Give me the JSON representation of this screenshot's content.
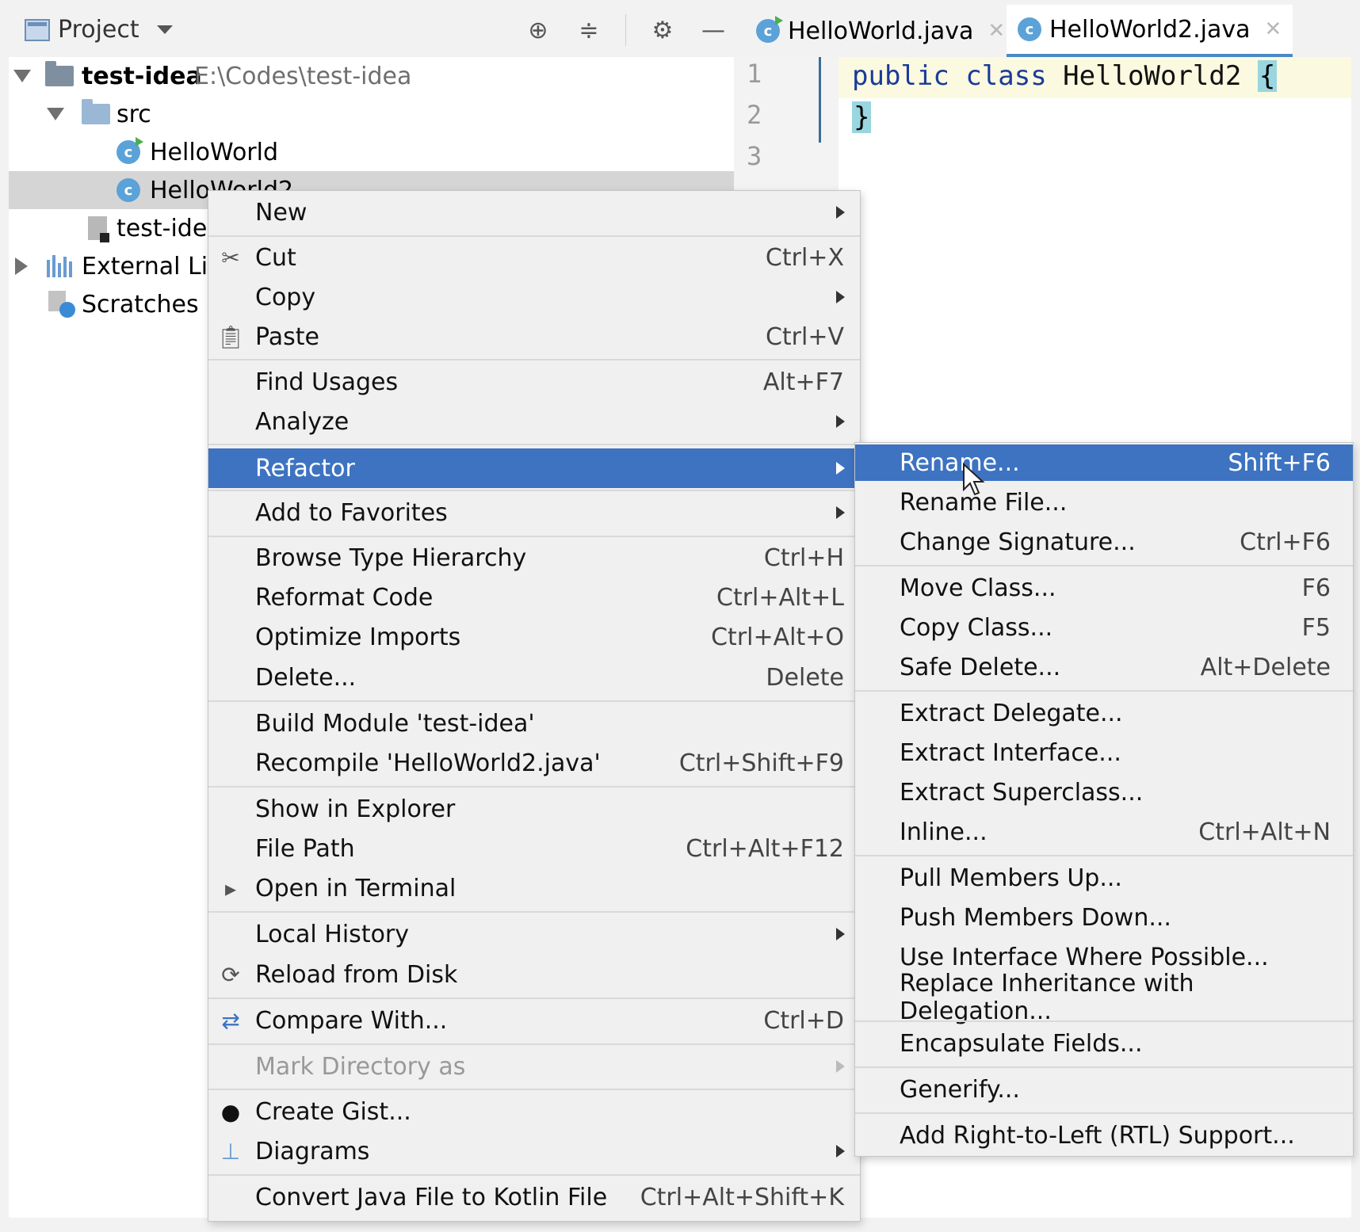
{
  "project_panel": {
    "title": "Project",
    "tree": {
      "root_name": "test-idea",
      "root_path": "E:\\Codes\\test-idea",
      "src": "src",
      "file1": "HelloWorld",
      "file2": "HelloWorld2",
      "iml": "test-idea",
      "external": "External Lib",
      "scratches": "Scratches a"
    }
  },
  "editor": {
    "tabs": [
      {
        "label": "HelloWorld.java"
      },
      {
        "label": "HelloWorld2.java"
      }
    ],
    "line_numbers": [
      "1",
      "2",
      "3"
    ],
    "code": {
      "kw_public": "public",
      "kw_class": "class",
      "class_name": "HelloWorld2",
      "open_brace": "{",
      "close_brace": "}"
    }
  },
  "context_menu": {
    "items": [
      {
        "label": "New"
      },
      {
        "label": "Cut",
        "shortcut": "Ctrl+X"
      },
      {
        "label": "Copy"
      },
      {
        "label": "Paste",
        "shortcut": "Ctrl+V"
      },
      {
        "label": "Find Usages",
        "shortcut": "Alt+F7"
      },
      {
        "label": "Analyze"
      },
      {
        "label": "Refactor"
      },
      {
        "label": "Add to Favorites"
      },
      {
        "label": "Browse Type Hierarchy",
        "shortcut": "Ctrl+H"
      },
      {
        "label": "Reformat Code",
        "shortcut": "Ctrl+Alt+L"
      },
      {
        "label": "Optimize Imports",
        "shortcut": "Ctrl+Alt+O"
      },
      {
        "label": "Delete...",
        "shortcut": "Delete"
      },
      {
        "label": "Build Module 'test-idea'"
      },
      {
        "label": "Recompile 'HelloWorld2.java'",
        "shortcut": "Ctrl+Shift+F9"
      },
      {
        "label": "Show in Explorer"
      },
      {
        "label": "File Path",
        "shortcut": "Ctrl+Alt+F12"
      },
      {
        "label": "Open in Terminal"
      },
      {
        "label": "Local History"
      },
      {
        "label": "Reload from Disk"
      },
      {
        "label": "Compare With...",
        "shortcut": "Ctrl+D"
      },
      {
        "label": "Mark Directory as"
      },
      {
        "label": "Create Gist..."
      },
      {
        "label": "Diagrams"
      },
      {
        "label": "Convert Java File to Kotlin File",
        "shortcut": "Ctrl+Alt+Shift+K"
      }
    ]
  },
  "refactor_menu": {
    "items": [
      {
        "label": "Rename...",
        "shortcut": "Shift+F6"
      },
      {
        "label": "Rename File..."
      },
      {
        "label": "Change Signature...",
        "shortcut": "Ctrl+F6"
      },
      {
        "label": "Move Class...",
        "shortcut": "F6"
      },
      {
        "label": "Copy Class...",
        "shortcut": "F5"
      },
      {
        "label": "Safe Delete...",
        "shortcut": "Alt+Delete"
      },
      {
        "label": "Extract Delegate..."
      },
      {
        "label": "Extract Interface..."
      },
      {
        "label": "Extract Superclass..."
      },
      {
        "label": "Inline...",
        "shortcut": "Ctrl+Alt+N"
      },
      {
        "label": "Pull Members Up..."
      },
      {
        "label": "Push Members Down..."
      },
      {
        "label": "Use Interface Where Possible..."
      },
      {
        "label": "Replace Inheritance with Delegation..."
      },
      {
        "label": "Encapsulate Fields..."
      },
      {
        "label": "Generify..."
      },
      {
        "label": "Add Right-to-Left (RTL) Support..."
      }
    ]
  },
  "colors": {
    "highlight": "#3d73c1",
    "menu_bg": "#f0f0f0",
    "keyword": "#1a3b9b",
    "brace_match": "#99d6e0"
  }
}
